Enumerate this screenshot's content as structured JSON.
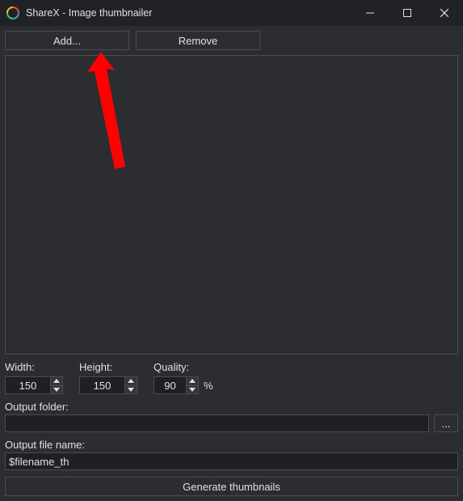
{
  "title": "ShareX - Image thumbnailer",
  "buttons": {
    "add": "Add...",
    "remove": "Remove",
    "browse": "...",
    "generate": "Generate thumbnails"
  },
  "settings": {
    "width": {
      "label": "Width:",
      "value": "150"
    },
    "height": {
      "label": "Height:",
      "value": "150"
    },
    "quality": {
      "label": "Quality:",
      "value": "90",
      "suffix": "%"
    }
  },
  "output_folder": {
    "label": "Output folder:",
    "value": ""
  },
  "output_filename": {
    "label": "Output file name:",
    "value": "$filename_th"
  },
  "icons": {
    "app": "sharex-logo-icon",
    "min": "minimize-icon",
    "max": "maximize-icon",
    "close": "close-icon"
  }
}
